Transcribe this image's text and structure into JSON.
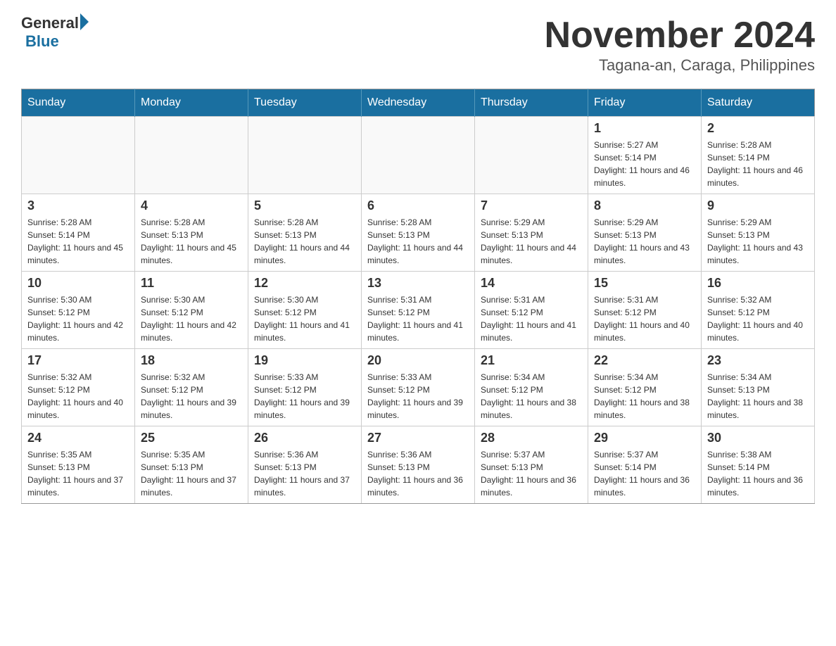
{
  "logo": {
    "general": "General",
    "blue": "Blue"
  },
  "header": {
    "month_year": "November 2024",
    "location": "Tagana-an, Caraga, Philippines"
  },
  "days_of_week": [
    "Sunday",
    "Monday",
    "Tuesday",
    "Wednesday",
    "Thursday",
    "Friday",
    "Saturday"
  ],
  "weeks": [
    {
      "cells": [
        {
          "day": "",
          "info": ""
        },
        {
          "day": "",
          "info": ""
        },
        {
          "day": "",
          "info": ""
        },
        {
          "day": "",
          "info": ""
        },
        {
          "day": "",
          "info": ""
        },
        {
          "day": "1",
          "info": "Sunrise: 5:27 AM\nSunset: 5:14 PM\nDaylight: 11 hours and 46 minutes."
        },
        {
          "day": "2",
          "info": "Sunrise: 5:28 AM\nSunset: 5:14 PM\nDaylight: 11 hours and 46 minutes."
        }
      ]
    },
    {
      "cells": [
        {
          "day": "3",
          "info": "Sunrise: 5:28 AM\nSunset: 5:14 PM\nDaylight: 11 hours and 45 minutes."
        },
        {
          "day": "4",
          "info": "Sunrise: 5:28 AM\nSunset: 5:13 PM\nDaylight: 11 hours and 45 minutes."
        },
        {
          "day": "5",
          "info": "Sunrise: 5:28 AM\nSunset: 5:13 PM\nDaylight: 11 hours and 44 minutes."
        },
        {
          "day": "6",
          "info": "Sunrise: 5:28 AM\nSunset: 5:13 PM\nDaylight: 11 hours and 44 minutes."
        },
        {
          "day": "7",
          "info": "Sunrise: 5:29 AM\nSunset: 5:13 PM\nDaylight: 11 hours and 44 minutes."
        },
        {
          "day": "8",
          "info": "Sunrise: 5:29 AM\nSunset: 5:13 PM\nDaylight: 11 hours and 43 minutes."
        },
        {
          "day": "9",
          "info": "Sunrise: 5:29 AM\nSunset: 5:13 PM\nDaylight: 11 hours and 43 minutes."
        }
      ]
    },
    {
      "cells": [
        {
          "day": "10",
          "info": "Sunrise: 5:30 AM\nSunset: 5:12 PM\nDaylight: 11 hours and 42 minutes."
        },
        {
          "day": "11",
          "info": "Sunrise: 5:30 AM\nSunset: 5:12 PM\nDaylight: 11 hours and 42 minutes."
        },
        {
          "day": "12",
          "info": "Sunrise: 5:30 AM\nSunset: 5:12 PM\nDaylight: 11 hours and 41 minutes."
        },
        {
          "day": "13",
          "info": "Sunrise: 5:31 AM\nSunset: 5:12 PM\nDaylight: 11 hours and 41 minutes."
        },
        {
          "day": "14",
          "info": "Sunrise: 5:31 AM\nSunset: 5:12 PM\nDaylight: 11 hours and 41 minutes."
        },
        {
          "day": "15",
          "info": "Sunrise: 5:31 AM\nSunset: 5:12 PM\nDaylight: 11 hours and 40 minutes."
        },
        {
          "day": "16",
          "info": "Sunrise: 5:32 AM\nSunset: 5:12 PM\nDaylight: 11 hours and 40 minutes."
        }
      ]
    },
    {
      "cells": [
        {
          "day": "17",
          "info": "Sunrise: 5:32 AM\nSunset: 5:12 PM\nDaylight: 11 hours and 40 minutes."
        },
        {
          "day": "18",
          "info": "Sunrise: 5:32 AM\nSunset: 5:12 PM\nDaylight: 11 hours and 39 minutes."
        },
        {
          "day": "19",
          "info": "Sunrise: 5:33 AM\nSunset: 5:12 PM\nDaylight: 11 hours and 39 minutes."
        },
        {
          "day": "20",
          "info": "Sunrise: 5:33 AM\nSunset: 5:12 PM\nDaylight: 11 hours and 39 minutes."
        },
        {
          "day": "21",
          "info": "Sunrise: 5:34 AM\nSunset: 5:12 PM\nDaylight: 11 hours and 38 minutes."
        },
        {
          "day": "22",
          "info": "Sunrise: 5:34 AM\nSunset: 5:12 PM\nDaylight: 11 hours and 38 minutes."
        },
        {
          "day": "23",
          "info": "Sunrise: 5:34 AM\nSunset: 5:13 PM\nDaylight: 11 hours and 38 minutes."
        }
      ]
    },
    {
      "cells": [
        {
          "day": "24",
          "info": "Sunrise: 5:35 AM\nSunset: 5:13 PM\nDaylight: 11 hours and 37 minutes."
        },
        {
          "day": "25",
          "info": "Sunrise: 5:35 AM\nSunset: 5:13 PM\nDaylight: 11 hours and 37 minutes."
        },
        {
          "day": "26",
          "info": "Sunrise: 5:36 AM\nSunset: 5:13 PM\nDaylight: 11 hours and 37 minutes."
        },
        {
          "day": "27",
          "info": "Sunrise: 5:36 AM\nSunset: 5:13 PM\nDaylight: 11 hours and 36 minutes."
        },
        {
          "day": "28",
          "info": "Sunrise: 5:37 AM\nSunset: 5:13 PM\nDaylight: 11 hours and 36 minutes."
        },
        {
          "day": "29",
          "info": "Sunrise: 5:37 AM\nSunset: 5:14 PM\nDaylight: 11 hours and 36 minutes."
        },
        {
          "day": "30",
          "info": "Sunrise: 5:38 AM\nSunset: 5:14 PM\nDaylight: 11 hours and 36 minutes."
        }
      ]
    }
  ]
}
